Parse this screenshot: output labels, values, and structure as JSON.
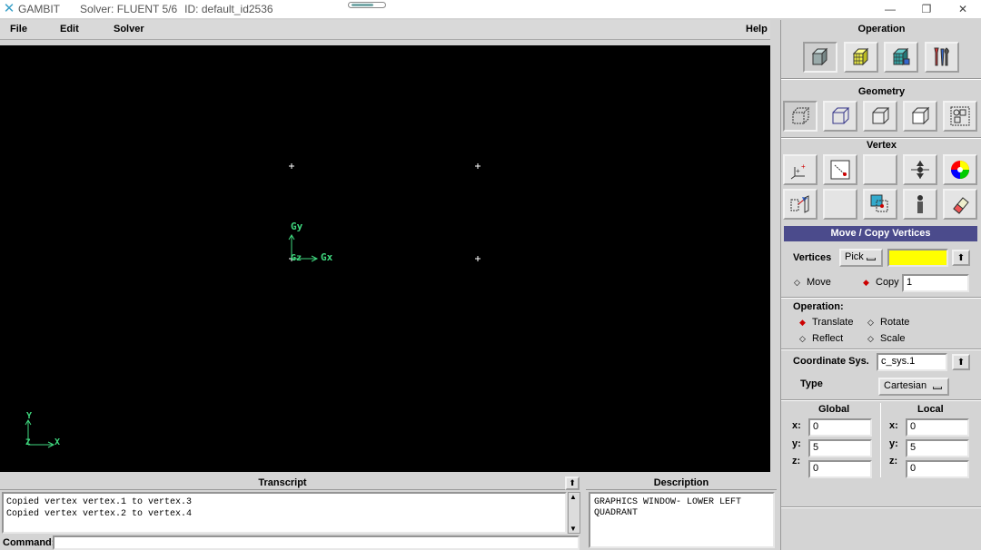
{
  "window": {
    "app_name": "GAMBIT",
    "solver_text": "Solver: FLUENT 5/6",
    "id_text": "ID: default_id2536",
    "minimize_icon": "—",
    "restore_icon": "❐",
    "close_icon": "✕"
  },
  "menu": {
    "file": "File",
    "edit": "Edit",
    "solver": "Solver",
    "help": "Help"
  },
  "graphics": {
    "vertices": [
      {
        "x": 0,
        "y": 5
      },
      {
        "x": 5,
        "y": 5
      },
      {
        "x": 0,
        "y": 0
      },
      {
        "x": 5,
        "y": 0
      }
    ],
    "gx_label": "Gx",
    "gy_label": "Gy",
    "gz_label": "Gz",
    "view_x_label": "X",
    "view_y_label": "Y",
    "view_z_label": "Z",
    "axis_color": "#3fd97f"
  },
  "panel": {
    "operation_title": "Operation",
    "geometry_title": "Geometry",
    "vertex_title": "Vertex",
    "form_title": "Move / Copy Vertices",
    "vertices_label": "Vertices",
    "pick_label": "Pick",
    "vertices_value": "",
    "vertices_field_color": "#ffff00",
    "move_label": "Move",
    "copy_label": "Copy",
    "copy_count": "1",
    "operation_label": "Operation:",
    "translate_label": "Translate",
    "rotate_label": "Rotate",
    "reflect_label": "Reflect",
    "scale_label": "Scale",
    "coord_sys_label": "Coordinate Sys.",
    "coord_sys_value": "c_sys.1",
    "type_label": "Type",
    "type_value": "Cartesian",
    "global_label": "Global",
    "local_label": "Local",
    "x_label": "x:",
    "y_label": "y:",
    "z_label": "z:",
    "global": {
      "x": "0",
      "y": "5",
      "z": "0"
    },
    "local": {
      "x": "0",
      "y": "5",
      "z": "0"
    }
  },
  "transcript": {
    "title": "Transcript",
    "lines": "Copied vertex vertex.1 to vertex.3\nCopied vertex vertex.2 to vertex.4",
    "command_label": "Command:",
    "command_value": ""
  },
  "description": {
    "title": "Description",
    "text": "GRAPHICS WINDOW- LOWER LEFT QUADRANT"
  }
}
